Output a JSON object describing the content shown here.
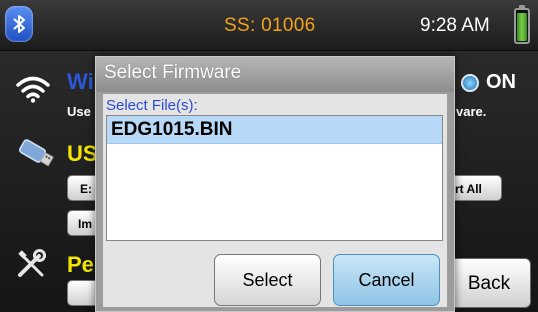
{
  "status_bar": {
    "serial": "SS: 01006",
    "time": "9:28 AM",
    "icons": {
      "bluetooth": "bluetooth-icon",
      "battery": "battery-icon"
    },
    "colors": {
      "serial_text": "#f3a21c"
    }
  },
  "background": {
    "wifi": {
      "title_fragment": "Wi",
      "desc_fragment": "Use",
      "desc_fragment_right": "vare.",
      "status": "ON",
      "icon": "wifi-icon"
    },
    "usb": {
      "title_fragment": "US",
      "icon": "usb-drive-icon",
      "btn_export_fragment": "E:",
      "btn_export_all_fragment": "rt All",
      "btn_import_fragment": "Im"
    },
    "pe": {
      "title_fragment": "Pe",
      "icon": "tools-icon"
    },
    "back_label": "Back",
    "colors": {
      "wifi_title": "#2a58d8",
      "section_title": "#f4e600"
    }
  },
  "dialog": {
    "title": "Select Firmware",
    "file_label": "Select File(s):",
    "files": [
      {
        "name": "EDG1015.BIN",
        "selected": true
      }
    ],
    "select_label": "Select",
    "cancel_label": "Cancel",
    "colors": {
      "selected_row": "#b7d9f7",
      "label": "#2a49d8"
    }
  }
}
